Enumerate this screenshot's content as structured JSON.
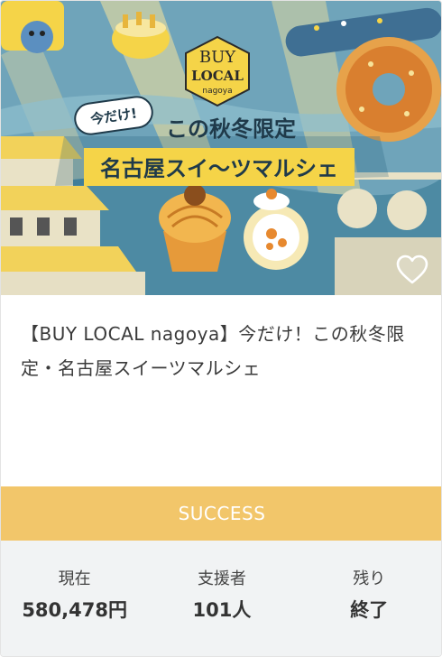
{
  "banner": {
    "logo_line1": "BUY",
    "logo_line2": "LOCAL",
    "logo_sub": "nagoya",
    "tag": "今だけ!",
    "headline": "この秋冬限定",
    "subheadline": "名古屋スイ〜ツマルシェ"
  },
  "favorite": {
    "icon": "heart-outline-icon"
  },
  "project": {
    "title": "【BUY LOCAL nagoya】今だけ！この秋冬限定・名古屋スイーツマルシェ"
  },
  "status": {
    "label": "SUCCESS",
    "color": "#f2c66a"
  },
  "stats": [
    {
      "label": "現在",
      "value": "580,478円"
    },
    {
      "label": "支援者",
      "value": "101人"
    },
    {
      "label": "残り",
      "value": "終了"
    }
  ],
  "colors": {
    "banner_bg": "#6a9fb5",
    "accent_yellow": "#f5d448",
    "panel_bg": "#f1f3f4"
  }
}
